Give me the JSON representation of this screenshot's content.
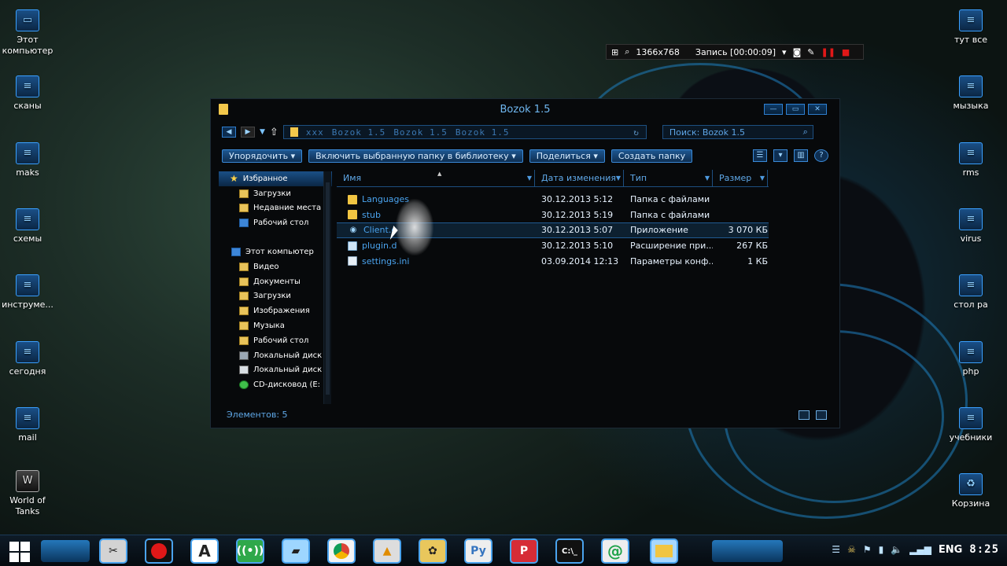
{
  "desktop": {
    "left_icons": [
      {
        "label": "Этот компьютер",
        "icon": "computer-icon"
      },
      {
        "label": "сканы",
        "icon": "folder-icon"
      },
      {
        "label": "maks",
        "icon": "folder-icon"
      },
      {
        "label": "схемы",
        "icon": "folder-icon"
      },
      {
        "label": "инструме...",
        "icon": "folder-icon"
      },
      {
        "label": "сегодня",
        "icon": "folder-icon"
      },
      {
        "label": "mail",
        "icon": "folder-icon"
      },
      {
        "label": "World of Tanks",
        "icon": "world-of-tanks-icon"
      }
    ],
    "right_icons": [
      {
        "label": "тут все",
        "icon": "folder-icon"
      },
      {
        "label": "мызыка",
        "icon": "folder-icon"
      },
      {
        "label": "rms",
        "icon": "folder-icon"
      },
      {
        "label": "virus",
        "icon": "folder-icon"
      },
      {
        "label": "стол ра",
        "icon": "folder-icon"
      },
      {
        "label": "php",
        "icon": "folder-icon"
      },
      {
        "label": "учебники",
        "icon": "folder-icon"
      },
      {
        "label": "Корзина",
        "icon": "recycle-bin-icon"
      }
    ]
  },
  "recorder": {
    "resolution": "1366x768",
    "status": "Запись [00:00:09]"
  },
  "explorer": {
    "title": "Bozok 1.5",
    "address_segments": [
      "xxx",
      "Bozok 1.5",
      "Bozok 1.5",
      "Bozok 1.5"
    ],
    "search_placeholder": "Поиск: Bozok 1.5",
    "commands": {
      "organize": "Упорядочить",
      "include_library": "Включить выбранную папку в библиотеку",
      "share": "Поделиться",
      "new_folder": "Создать папку"
    },
    "nav": {
      "favorites": "Избранное",
      "fav_items": [
        "Загрузки",
        "Недавние места",
        "Рабочий стол"
      ],
      "this_pc": "Этот компьютер",
      "pc_items": [
        "Видео",
        "Документы",
        "Загрузки",
        "Изображения",
        "Музыка",
        "Рабочий стол",
        "Локальный диск (",
        "Локальный диск (",
        "CD-дисковод (E:"
      ]
    },
    "columns": {
      "name": "Имя",
      "date": "Дата изменения",
      "type": "Тип",
      "size": "Размер"
    },
    "files": [
      {
        "name": "Languages",
        "date": "30.12.2013 5:12",
        "type": "Папка с файлами",
        "size": "",
        "kind": "folder"
      },
      {
        "name": "stub",
        "date": "30.12.2013 5:19",
        "type": "Папка с файлами",
        "size": "",
        "kind": "folder"
      },
      {
        "name": "Client.e",
        "date": "30.12.2013 5:07",
        "type": "Приложение",
        "size": "3 070 КБ",
        "kind": "exe"
      },
      {
        "name": "plugin.d",
        "date": "30.12.2013 5:10",
        "type": "Расширение при...",
        "size": "267 КБ",
        "kind": "dll"
      },
      {
        "name": "settings.ini",
        "date": "03.09.2014 12:13",
        "type": "Параметры конф...",
        "size": "1 КБ",
        "kind": "ini"
      }
    ],
    "status": "Элементов: 5"
  },
  "taskbar": {
    "lang": "ENG",
    "clock": "8:25"
  }
}
